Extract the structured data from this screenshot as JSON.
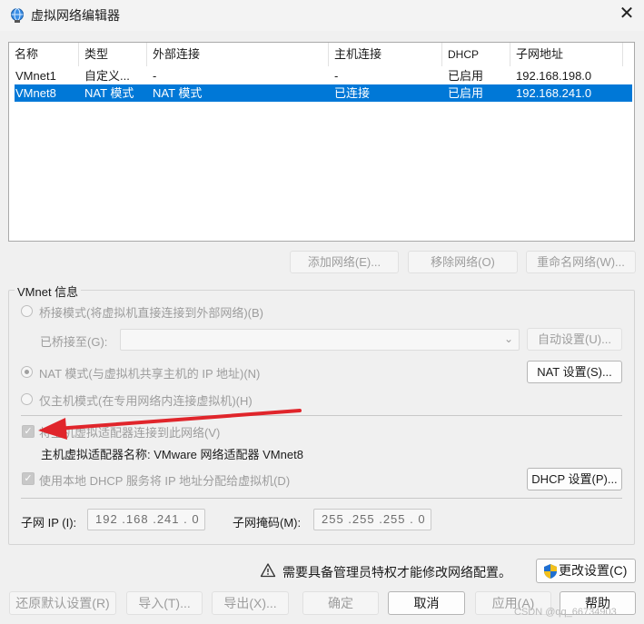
{
  "window": {
    "title": "虚拟网络编辑器",
    "close_label": "✕"
  },
  "table": {
    "columns": [
      "名称",
      "类型",
      "外部连接",
      "主机连接",
      "DHCP",
      "子网地址"
    ],
    "rows": [
      {
        "name": "VMnet1",
        "type": "自定义...",
        "external": "-",
        "host": "-",
        "dhcp": "已启用",
        "subnet": "192.168.198.0",
        "selected": false
      },
      {
        "name": "VMnet8",
        "type": "NAT 模式",
        "external": "NAT 模式",
        "host": "已连接",
        "dhcp": "已启用",
        "subnet": "192.168.241.0",
        "selected": true
      }
    ]
  },
  "network_buttons": {
    "add": "添加网络(E)...",
    "remove": "移除网络(O)",
    "rename": "重命名网络(W)..."
  },
  "vmnet_info": {
    "group_title": "VMnet 信息",
    "bridged_mode": "桥接模式(将虚拟机直接连接到外部网络)(B)",
    "bridged_to_label": "已桥接至(G):",
    "bridged_to_value": "",
    "auto_settings": "自动设置(U)...",
    "nat_mode": "NAT 模式(与虚拟机共享主机的 IP 地址)(N)",
    "nat_settings": "NAT 设置(S)...",
    "host_only_mode": "仅主机模式(在专用网络内连接虚拟机)(H)",
    "connect_adapter": "将主机虚拟适配器连接到此网络(V)",
    "adapter_name": "主机虚拟适配器名称: VMware 网络适配器 VMnet8",
    "use_dhcp": "使用本地 DHCP 服务将 IP 地址分配给虚拟机(D)",
    "dhcp_settings": "DHCP 设置(P)...",
    "subnet_ip_label": "子网 IP (I):",
    "subnet_ip": "192 .168 .241 . 0",
    "subnet_mask_label": "子网掩码(M):",
    "subnet_mask": "255 .255 .255 . 0"
  },
  "admin": {
    "notice": "需要具备管理员特权才能修改网络配置。",
    "change_settings": "更改设置(C)"
  },
  "footer_buttons": {
    "restore_defaults": "还原默认设置(R)",
    "import": "导入(T)...",
    "export": "导出(X)...",
    "ok": "确定",
    "cancel": "取消",
    "apply": "应用(A)",
    "help": "帮助"
  },
  "watermark": "CSDN @qq_66734903",
  "colors": {
    "selection": "#0078d7",
    "annotation_arrow": "#e0252b"
  }
}
